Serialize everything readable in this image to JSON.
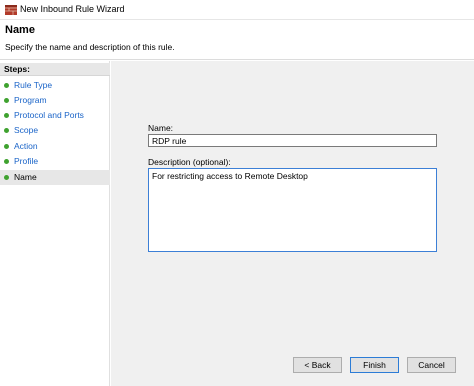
{
  "window": {
    "title": "New Inbound Rule Wizard",
    "icon": "firewall-app-icon"
  },
  "header": {
    "title": "Name",
    "subtitle": "Specify the name and description of this rule."
  },
  "sidebar": {
    "steps_title": "Steps:",
    "items": [
      {
        "label": "Rule Type",
        "status": "completed"
      },
      {
        "label": "Program",
        "status": "completed"
      },
      {
        "label": "Protocol and Ports",
        "status": "completed"
      },
      {
        "label": "Scope",
        "status": "completed"
      },
      {
        "label": "Action",
        "status": "completed"
      },
      {
        "label": "Profile",
        "status": "completed"
      },
      {
        "label": "Name",
        "status": "current"
      }
    ],
    "status_color": "#3fa22f",
    "link_color": "#1a64c8"
  },
  "form": {
    "name_label": "Name:",
    "name_value": "RDP rule",
    "description_label": "Description (optional):",
    "description_value": "For restricting access to Remote Desktop"
  },
  "buttons": {
    "back": "< Back",
    "finish": "Finish",
    "cancel": "Cancel"
  }
}
